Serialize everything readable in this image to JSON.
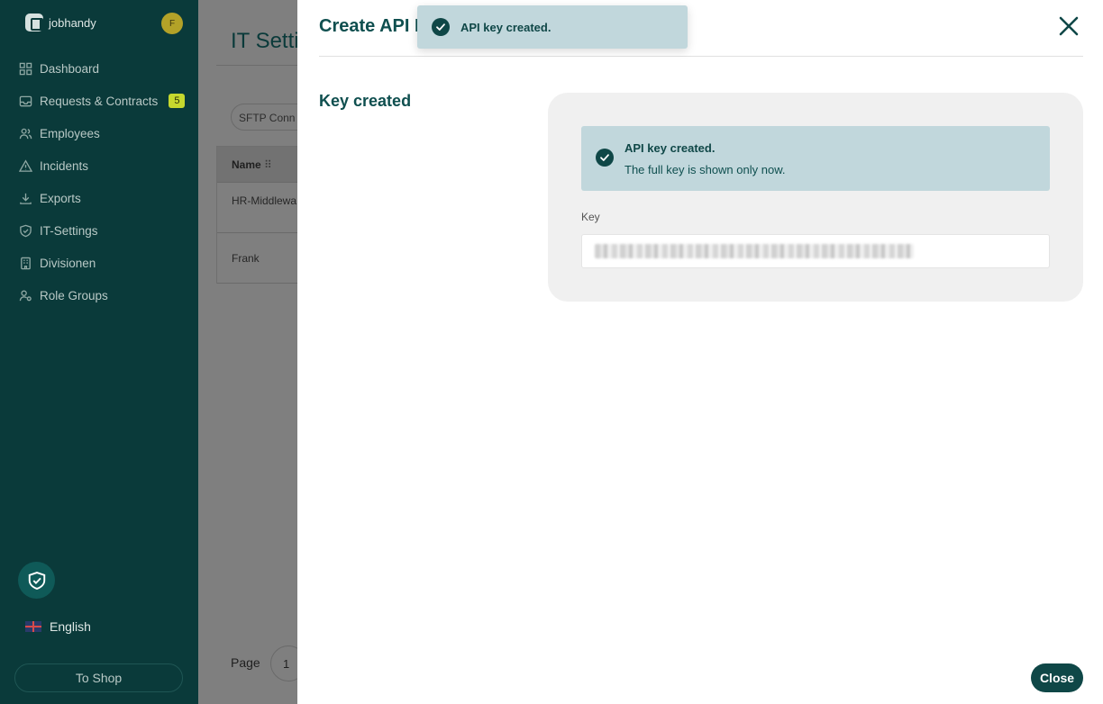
{
  "sidebar": {
    "brand": "jobhandy",
    "avatar_initial": "F",
    "items": [
      {
        "label": "Dashboard",
        "icon": "dashboard-icon"
      },
      {
        "label": "Requests & Contracts",
        "icon": "inbox-icon",
        "badge": "5"
      },
      {
        "label": "Employees",
        "icon": "users-icon"
      },
      {
        "label": "Incidents",
        "icon": "warning-icon"
      },
      {
        "label": "Exports",
        "icon": "download-icon"
      },
      {
        "label": "IT-Settings",
        "icon": "shield-icon"
      },
      {
        "label": "Divisionen",
        "icon": "building-icon"
      },
      {
        "label": "Role Groups",
        "icon": "role-icon"
      }
    ],
    "language": "English",
    "shop_button": "To Shop"
  },
  "background_page": {
    "title": "IT Setti",
    "chip": "SFTP Conn",
    "table_header": "Name",
    "rows": [
      "HR-Middlewa Production",
      "Frank"
    ],
    "page_label": "Page",
    "page_number": "1"
  },
  "drawer": {
    "title": "Create API K",
    "section_label": "Key created",
    "alert_title": "API key created.",
    "alert_text": "The full key is shown only now.",
    "key_label": "Key",
    "close_button": "Close"
  },
  "toast": {
    "message": "API key created."
  },
  "colors": {
    "sidebar_bg": "#0a3a3a",
    "accent": "#0f4747",
    "alert_bg": "#c1d7dc",
    "badge_bg": "#c6d82e"
  }
}
